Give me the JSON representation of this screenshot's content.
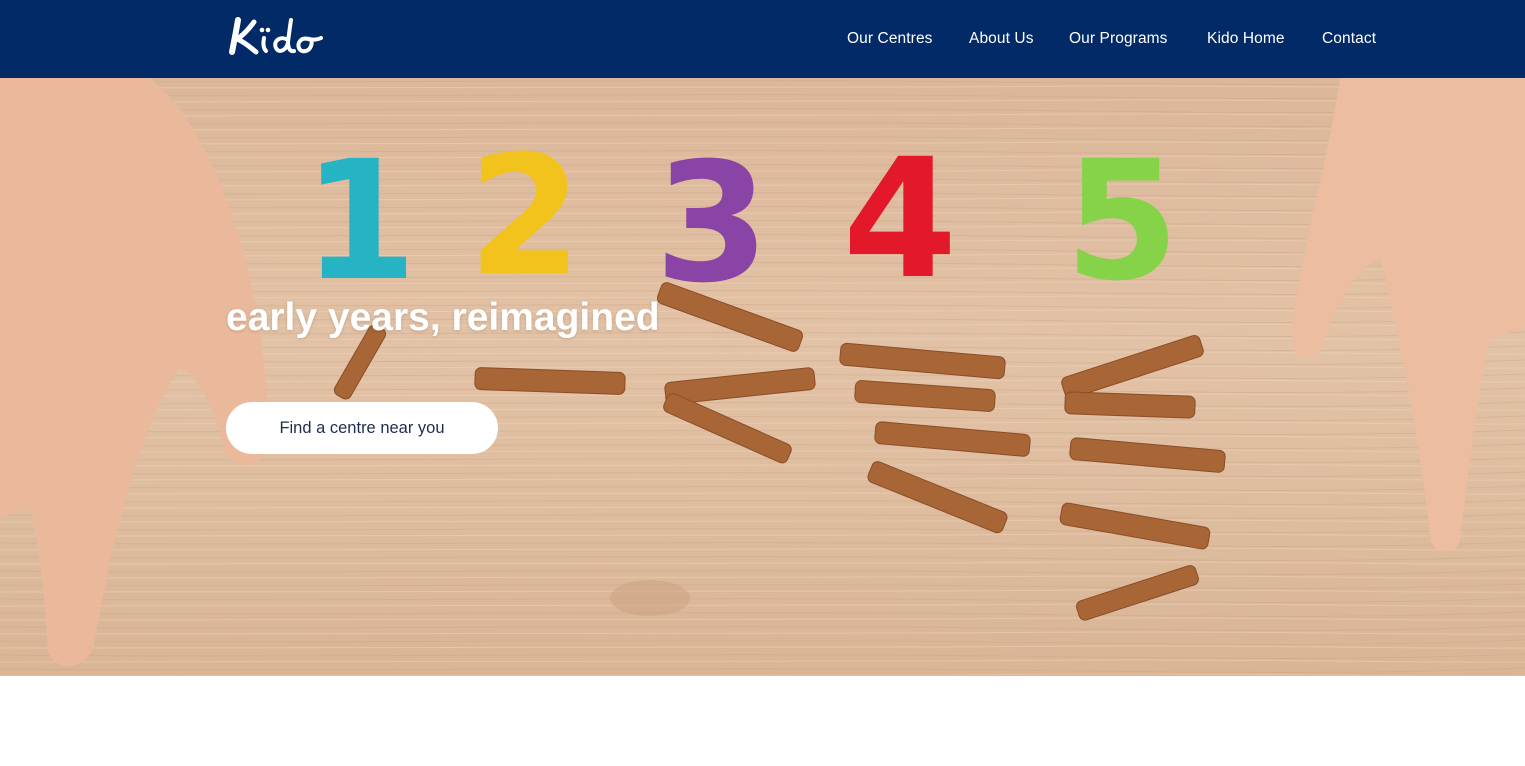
{
  "header": {
    "logo_text": "Kido",
    "nav": [
      {
        "label": "Our Centres"
      },
      {
        "label": "About Us"
      },
      {
        "label": "Our Programs"
      },
      {
        "label": "Kido Home"
      },
      {
        "label": "Contact"
      }
    ]
  },
  "hero": {
    "heading": "early years, reimagined",
    "cta_label": "Find a centre near you",
    "numbers": [
      "1",
      "2",
      "3",
      "4",
      "5"
    ]
  },
  "colors": {
    "nav_background": "#012a66",
    "hero_text": "#ffffff",
    "cta_background": "#ffffff",
    "cta_text": "#1f2d4d"
  }
}
